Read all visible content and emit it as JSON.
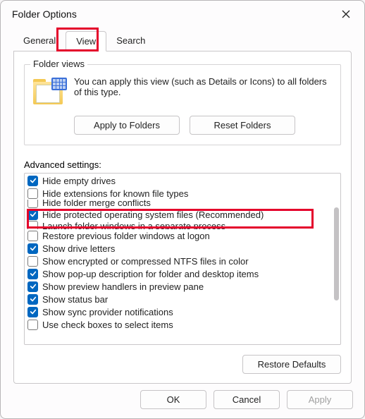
{
  "window": {
    "title": "Folder Options"
  },
  "tabs": {
    "general": "General",
    "view": "View",
    "search": "Search",
    "active": "view"
  },
  "folder_views": {
    "legend": "Folder views",
    "desc": "You can apply this view (such as Details or Icons) to all folders of this type.",
    "apply_btn": "Apply to Folders",
    "reset_btn": "Reset Folders"
  },
  "advanced": {
    "label": "Advanced settings:",
    "items": [
      {
        "label": "Hide empty drives",
        "checked": true
      },
      {
        "label": "Hide extensions for known file types",
        "checked": false
      },
      {
        "label": "Hide folder merge conflicts",
        "checked": false,
        "cut": "top"
      },
      {
        "label": "Hide protected operating system files (Recommended)",
        "checked": true,
        "highlight": true
      },
      {
        "label": "Launch folder windows in a separate process",
        "checked": false,
        "cut": "bot"
      },
      {
        "label": "Restore previous folder windows at logon",
        "checked": false
      },
      {
        "label": "Show drive letters",
        "checked": true
      },
      {
        "label": "Show encrypted or compressed NTFS files in color",
        "checked": false
      },
      {
        "label": "Show pop-up description for folder and desktop items",
        "checked": true
      },
      {
        "label": "Show preview handlers in preview pane",
        "checked": true
      },
      {
        "label": "Show status bar",
        "checked": true
      },
      {
        "label": "Show sync provider notifications",
        "checked": true
      },
      {
        "label": "Use check boxes to select items",
        "checked": false
      }
    ]
  },
  "buttons": {
    "restore_defaults": "Restore Defaults",
    "ok": "OK",
    "cancel": "Cancel",
    "apply": "Apply"
  }
}
